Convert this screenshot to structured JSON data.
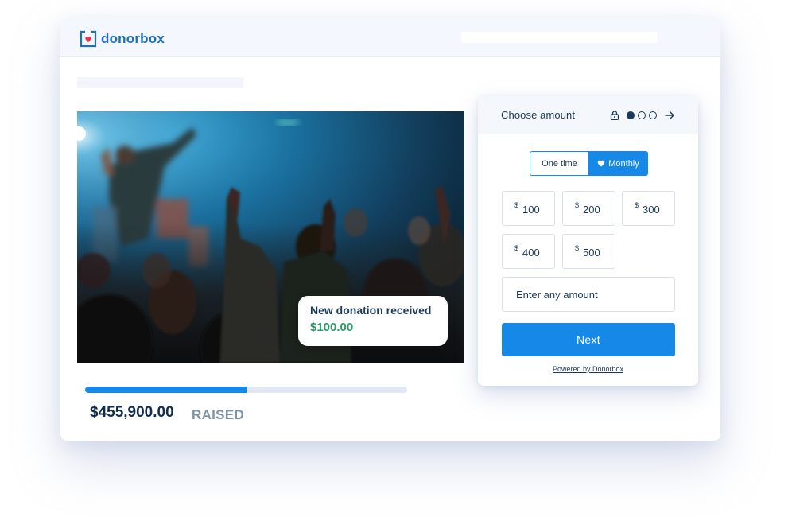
{
  "brand": {
    "name": "donorbox",
    "color": "#1a6fc3",
    "heart_color": "#e8344e"
  },
  "campaign": {
    "notification": {
      "title": "New donation received",
      "amount": "$100.00"
    },
    "progress": {
      "fraction": 0.5
    },
    "raised_amount": "$455,900.00",
    "raised_label": "RAISED"
  },
  "widget": {
    "title": "Choose amount",
    "steps": {
      "lock_icon": "lock-icon",
      "total": 3,
      "current": 1,
      "next_icon": "arrow-right-icon"
    },
    "frequency": {
      "one_time_label": "One time",
      "monthly_label": "Monthly",
      "selected": "Monthly"
    },
    "currency_symbol": "$",
    "amounts": [
      "100",
      "200",
      "300",
      "400",
      "500"
    ],
    "custom_amount_placeholder": "Enter any amount",
    "next_label": "Next",
    "powered_by": "Powered by Donorbox"
  },
  "colors": {
    "accent": "#1688e8",
    "success": "#2b9a6b",
    "text": "#1c3a5a",
    "muted": "#7f93a6"
  }
}
